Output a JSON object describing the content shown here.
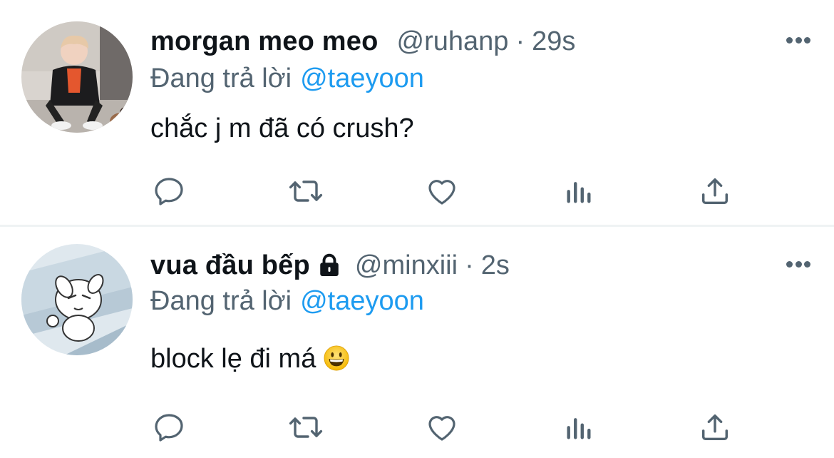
{
  "tweets": [
    {
      "author_name": "morgan meo meo",
      "author_handle": "@ruhanp",
      "separator": "·",
      "timestamp": "29s",
      "protected": false,
      "reply_prefix": "Đang trả lời",
      "reply_to": "@taeyoon",
      "text": "chắc j m đã có crush?",
      "emoji": "",
      "avatar_icon": "person-photo-avatar"
    },
    {
      "author_name": "vua đầu bếp",
      "author_handle": "@minxiii",
      "separator": "·",
      "timestamp": "2s",
      "protected": true,
      "reply_prefix": "Đang trả lời",
      "reply_to": "@taeyoon",
      "text": "block lẹ đi má",
      "emoji": "grinning-face-emoji",
      "avatar_icon": "cartoon-dog-avatar"
    }
  ],
  "actions": [
    "reply-icon",
    "retweet-icon",
    "like-icon",
    "views-icon",
    "share-icon"
  ],
  "colors": {
    "text": "#0f1419",
    "secondary": "#536471",
    "mention": "#1d9bf0",
    "divider": "#eff3f4"
  }
}
